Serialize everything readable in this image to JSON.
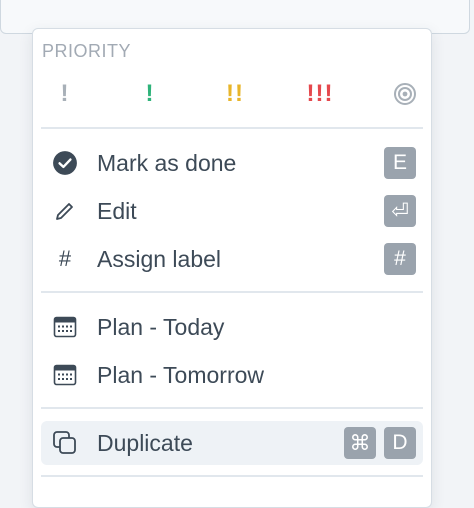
{
  "priority": {
    "label": "PRIORITY",
    "options": [
      {
        "glyph": "!",
        "color": "#a8b0b8"
      },
      {
        "glyph": "!",
        "color": "#2fb37a"
      },
      {
        "glyph": "!!",
        "color": "#e8b52a"
      },
      {
        "glyph": "!!!",
        "color": "#e5484d"
      }
    ],
    "clear_icon": "target-icon"
  },
  "menu": {
    "mark_done": {
      "label": "Mark as done",
      "icon": "check-circle-icon",
      "shortcut": "E"
    },
    "edit": {
      "label": "Edit",
      "icon": "pencil-icon",
      "shortcut": "⏎"
    },
    "assign_label": {
      "label": "Assign label",
      "icon": "hash-icon",
      "icon_glyph": "#",
      "shortcut": "#"
    },
    "plan_today": {
      "label": "Plan - Today",
      "icon": "calendar-icon"
    },
    "plan_tomorrow": {
      "label": "Plan - Tomorrow",
      "icon": "calendar-icon"
    },
    "duplicate": {
      "label": "Duplicate",
      "icon": "duplicate-icon",
      "shortcut_mod": "⌘",
      "shortcut_key": "D"
    }
  },
  "colors": {
    "text": "#3d4a57",
    "icon": "#3d4a57",
    "kbd_bg": "#9aa3ad",
    "hover_bg": "#eef2f6"
  }
}
